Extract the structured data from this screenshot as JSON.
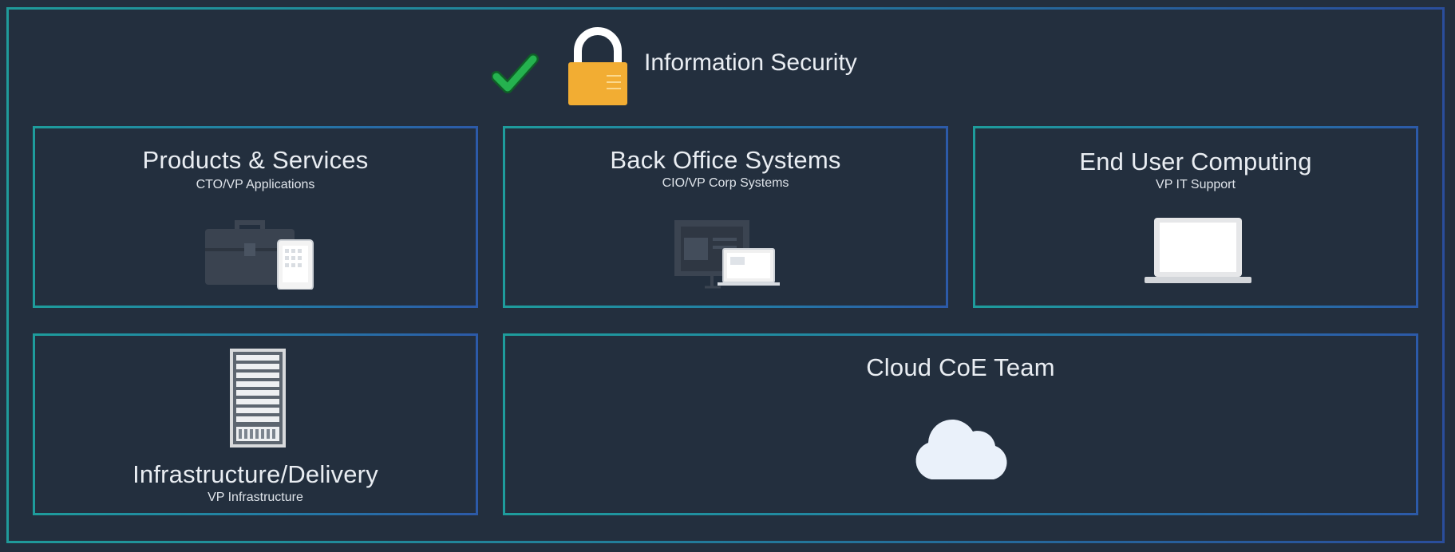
{
  "header": {
    "title": "Information Security",
    "icons": [
      "checkmark-icon",
      "padlock-icon"
    ],
    "check_color": "#1fa84a",
    "lock_color": "#f2ad33"
  },
  "boxes": [
    {
      "title": "Products & Services",
      "subtitle": "CTO/VP Applications",
      "icon": "briefcase-tablet-icon"
    },
    {
      "title": "Back Office Systems",
      "subtitle": "CIO/VP Corp Systems",
      "icon": "presentation-laptop-icon"
    },
    {
      "title": "End User Computing",
      "subtitle": "VP IT Support",
      "icon": "laptop-icon"
    },
    {
      "title": "Infrastructure/Delivery",
      "subtitle": "VP Infrastructure",
      "icon": "server-rack-icon"
    },
    {
      "title": "Cloud CoE Team",
      "subtitle": "",
      "icon": "cloud-icon"
    }
  ],
  "colors": {
    "background": "#232f3e",
    "border_teal": "#1e9c9c",
    "border_blue": "#2c5aa8"
  }
}
